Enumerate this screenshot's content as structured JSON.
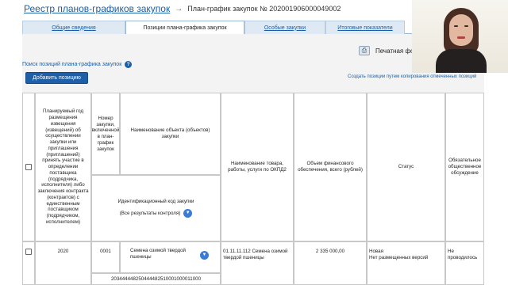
{
  "breadcrumb": {
    "root": "Реестр планов-графиков закупок",
    "arrow": "→",
    "current": "План-график закупок № 202001906000049002"
  },
  "tabs": [
    {
      "label": "Общие сведения",
      "active": false
    },
    {
      "label": "Позиции плана-графика закупок",
      "active": true
    },
    {
      "label": "Особые закупки",
      "active": false
    },
    {
      "label": "Итоговые показатели",
      "active": false
    }
  ],
  "toolbar": {
    "print_label": "Печатная фо",
    "search_link": "Поиск позиций плана-графика закупок",
    "help_glyph": "?",
    "add_button": "Добавить позицию",
    "copy_link": "Создать позиции путем копирования отмеченных позиций"
  },
  "table": {
    "headers": {
      "year": "Планируемый год размещения извещения (извещений) об осуществлении закупки или приглашения (приглашений) принять участие в определении поставщика (подрядчика, исполнителя) либо заключения контракта (контрактов) с единственным поставщиком (подрядчиком, исполнителем)",
      "number": "Номер закупки, включенной в план-график закупок",
      "object_name": "Наименование объекта (объектов) закупки",
      "ikz": "Идентификационный код закупки",
      "ikz_filter": "(Все результаты контроля)",
      "okpd2": "Наименование товара, работы, услуги по ОКПД2",
      "finance": "Объем финансового обеспечения, всего (рублей)",
      "status": "Статус",
      "discussion": "Обязательное общественное обсуждение"
    },
    "rows": [
      {
        "year": "2020",
        "number": "0001",
        "object_name": "Семена озимой твердой пшеницы",
        "ikz": "203444448250444482510001000011000",
        "okpd2": "01.11.11.112 Семена озимой твердой пшеницы",
        "finance": "2 335 000,00",
        "status": "Новая\nНет размещенных версий",
        "discussion": "Не проводилось"
      }
    ]
  },
  "icons": {
    "printer": "printer-icon",
    "help": "help-icon",
    "dropdown": "chevron-down-icon"
  },
  "colors": {
    "link": "#1a5fa8",
    "button_bg": "#1f5fa8",
    "tab_bg": "#dfe9f4",
    "panel_bg": "#f3f3f3"
  }
}
